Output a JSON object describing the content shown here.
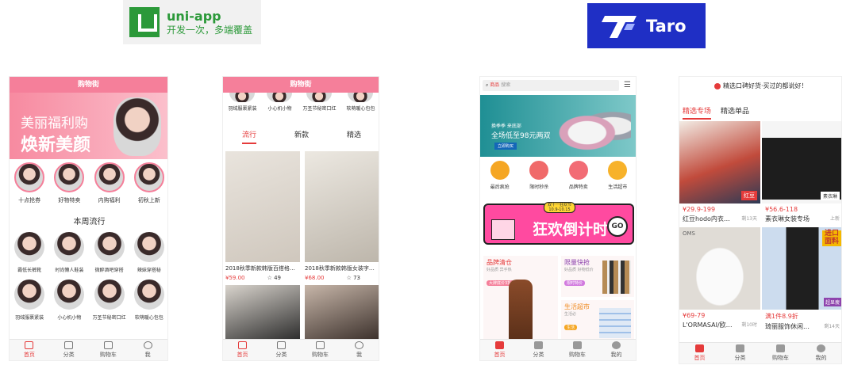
{
  "logos": {
    "uniapp": {
      "title": "uni-app",
      "subtitle": "开发一次，多端覆盖"
    },
    "taro": {
      "title": "Taro"
    }
  },
  "phone1": {
    "header": "购物街",
    "banner_line1": "美丽福利购",
    "banner_line2": "焕新美颜",
    "categories": [
      "十点抢券",
      "好物特卖",
      "内购福利",
      "初秋上新"
    ],
    "section_title": "本周流行",
    "grid_row1": [
      "霸低长裤靴",
      "时尚懒人鞋装",
      "微醉酒吧穿搭",
      "辣妹穿搭秘"
    ],
    "grid_row2": [
      "羽绒服裹紧装",
      "小心机小物",
      "万圣节秘密口红",
      "软萌暖心包包"
    ],
    "tabs": [
      "首页",
      "分类",
      "购物车",
      "我"
    ]
  },
  "phone2": {
    "header": "购物街",
    "top_items": [
      "羽绒服裹紧装",
      "小心机小物",
      "万圣节秘密口红",
      "软萌暖心包包"
    ],
    "segments": [
      "流行",
      "新款",
      "精选"
    ],
    "products": [
      {
        "title": "2018秋季新款韩版百搭格…",
        "price": "¥59.00",
        "fav": "☆ 49"
      },
      {
        "title": "2018秋季新款韩版女装字…",
        "price": "¥68.00",
        "fav": "☆ 73"
      }
    ],
    "tabs": [
      "首页",
      "分类",
      "购物车",
      "我"
    ]
  },
  "phone3": {
    "search_prefix": "商品",
    "search_placeholder": "搜索",
    "banner_sub": "换季季  来底部",
    "banner_main": "全场低至98元两双",
    "banner_btn": "立即购买",
    "icons": [
      "最后疯抢",
      "限时秒杀",
      "品牌特卖",
      "生活超市"
    ],
    "promo_badge": "双十一狂欢节",
    "promo_date": "10.9-10.15",
    "promo_text": "狂欢倒计时",
    "promo_go": "GO",
    "blocks": [
      {
        "title": "品牌清仓",
        "sub": "好品质  异手热",
        "tag": "大牌底价3折起"
      },
      {
        "title": "限量快抢",
        "sub": "好品质  好物低价",
        "tag": "限时特价"
      },
      {
        "title": "生活超市",
        "sub": "生活必",
        "tag": "生活"
      }
    ],
    "tabs": [
      "首页",
      "分类",
      "购物车",
      "我的"
    ]
  },
  "phone4": {
    "notice": "精选口碑好货·买过的都说好！",
    "tabs_top": [
      "精选专场",
      "精选单品"
    ],
    "products": [
      {
        "price": "¥29.9-199",
        "title": "红豆hodo内衣…",
        "meta": "剩13天",
        "tag": "红豆"
      },
      {
        "price": "¥56.6-118",
        "title": "素衣琳女装专场",
        "meta": "上新",
        "tag": "素衣琳"
      },
      {
        "price": "¥69-79",
        "title": "L'ORMASAI/欧…",
        "meta": "剩10时",
        "tag": "OMS"
      },
      {
        "price": "满1件8.9折",
        "title": "琦丽服饰休闲…",
        "meta": "剩14天",
        "tag": "进口面料",
        "tag2": "超显瘦"
      }
    ],
    "tabs": [
      "首页",
      "分类",
      "购物车",
      "我的"
    ]
  },
  "colors": {
    "accent": "#e53b3b",
    "pink": "#f57f9a",
    "uniapp": "#2b9939",
    "taro": "#1f2fc5"
  }
}
